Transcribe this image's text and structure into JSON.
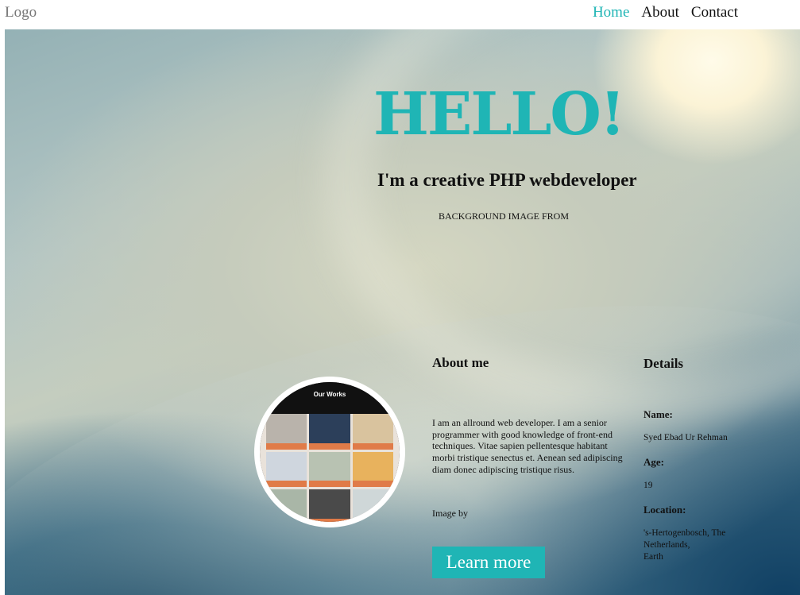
{
  "nav": {
    "logo": "Logo",
    "links": [
      {
        "label": "Home",
        "active": true
      },
      {
        "label": "About",
        "active": false
      },
      {
        "label": "Contact",
        "active": false
      }
    ]
  },
  "hero": {
    "title": "HELLO!",
    "subtitle": "I'm a creative PHP webdeveloper",
    "credit": "BACKGROUND IMAGE FROM"
  },
  "portrait": {
    "caption": "Our Works"
  },
  "about": {
    "title": "About me",
    "text": "I am an allround web developer. I am a senior programmer with good knowledge of front-end techniques. Vitae sapien pellentesque habitant morbi tristique senectus et. Aenean sed adipiscing diam donec adipiscing tristique risus.",
    "image_by": "Image by",
    "button_label": "Learn more"
  },
  "details": {
    "title": "Details",
    "name_label": "Name:",
    "name_value": "Syed Ebad Ur Rehman",
    "age_label": "Age:",
    "age_value": "19",
    "location_label": "Location:",
    "location_line1": "'s-Hertogenbosch, The",
    "location_line2": "Netherlands,",
    "location_line3": "Earth"
  },
  "colors": {
    "accent": "#1fb5b5",
    "text": "#111111",
    "logo": "#777777"
  }
}
